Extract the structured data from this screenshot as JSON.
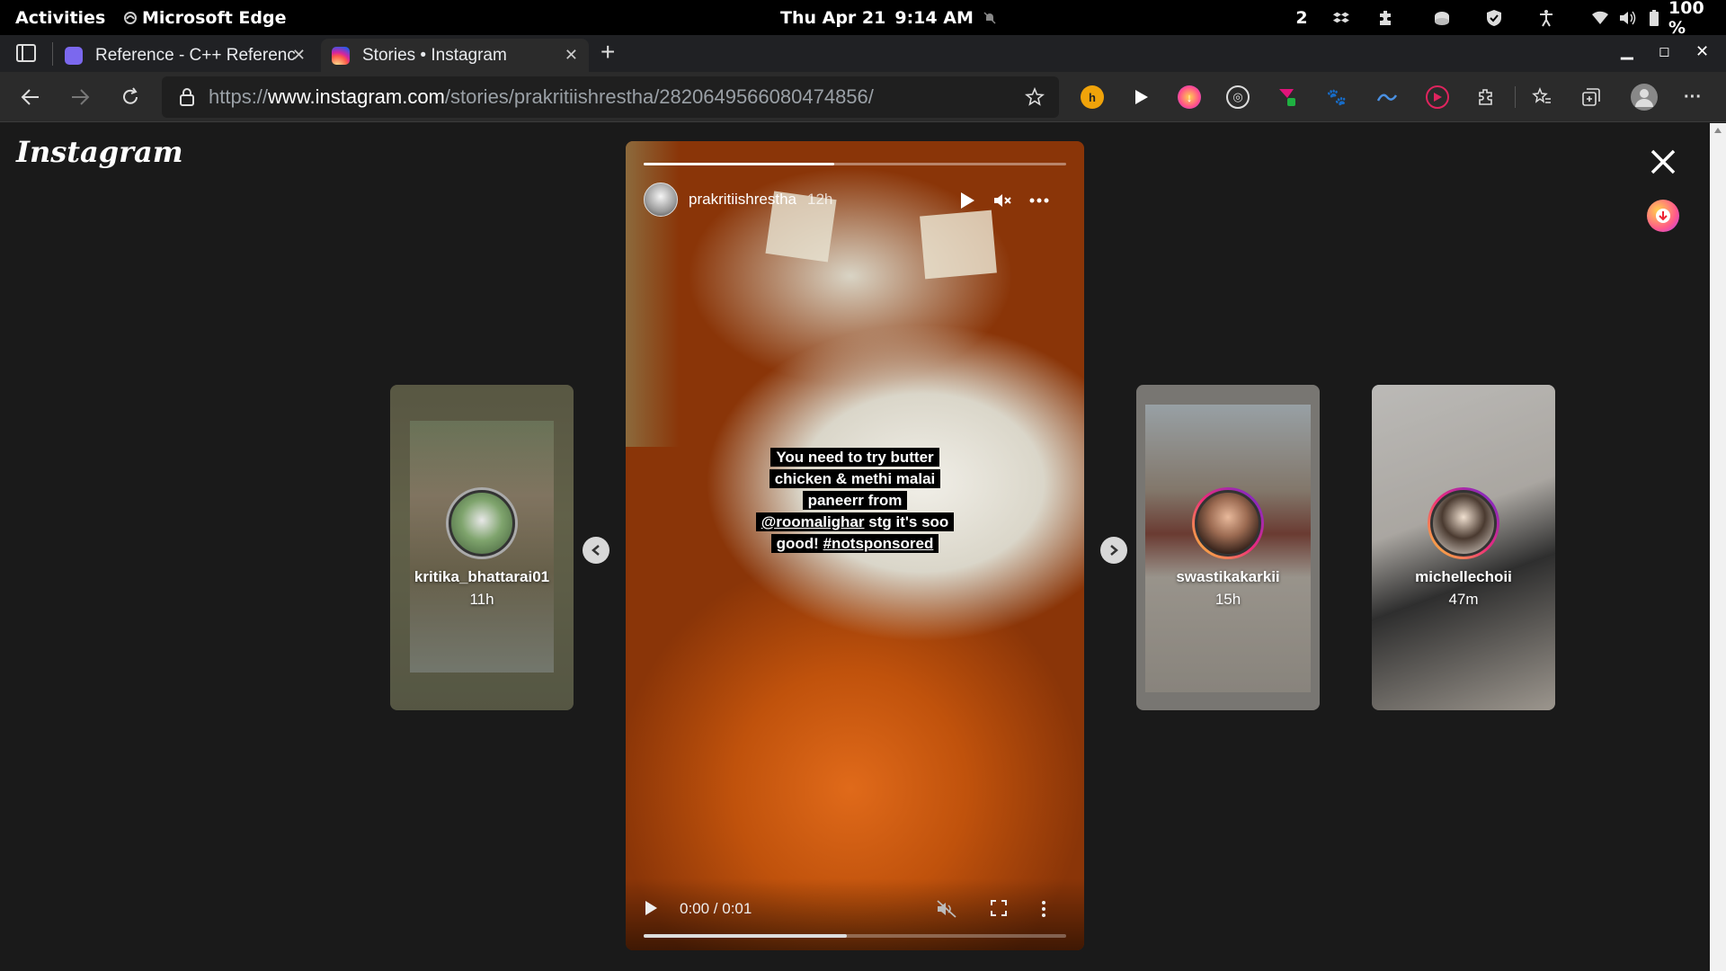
{
  "system_bar": {
    "activities": "Activities",
    "app_name": "Microsoft Edge",
    "date": "Thu Apr 21",
    "time": "9:14 AM",
    "workspace_count": "2",
    "battery": "100 %"
  },
  "browser": {
    "tabs": [
      {
        "label": "Reference - C++ Reference",
        "active": false,
        "favicon_color": "#7b68ee"
      },
      {
        "label": "Stories • Instagram",
        "active": true,
        "favicon_color": "#e1306c"
      }
    ],
    "new_tab_label": "+",
    "address": {
      "scheme": "https://",
      "host": "www.instagram.com",
      "path": "/stories/prakritiishrestha/2820649566080474856/"
    }
  },
  "instagram": {
    "logo": "Instagram",
    "story": {
      "username": "prakritiishrestha",
      "time_ago": "12h",
      "progress": 0.45,
      "caption_lines": [
        [
          {
            "text": "You need to try butter"
          }
        ],
        [
          {
            "text": "chicken & methi malai"
          }
        ],
        [
          {
            "text": "paneerr from"
          }
        ],
        [
          {
            "text": "@roomalighar",
            "link": true
          },
          {
            "text": " stg it's soo"
          }
        ],
        [
          {
            "text": "good! "
          },
          {
            "text": "#notsponsored",
            "link": true
          }
        ]
      ],
      "video": {
        "time": "0:00 / 0:01",
        "progress": 0.48
      }
    },
    "previews": [
      {
        "username": "kritika_bhattarai01",
        "time_ago": "11h",
        "seen": true
      },
      {
        "username": "swastikakarkii",
        "time_ago": "15h",
        "seen": false
      },
      {
        "username": "michellechoii",
        "time_ago": "47m",
        "seen": false
      }
    ]
  }
}
